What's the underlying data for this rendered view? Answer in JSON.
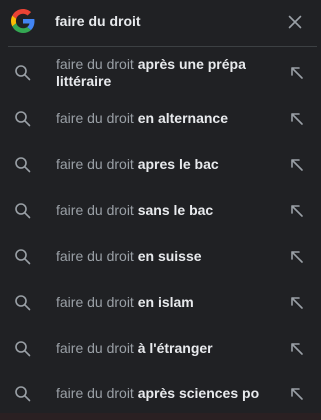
{
  "search": {
    "query": "faire du droit",
    "logo": "google-g-logo",
    "clear_icon": "close-icon"
  },
  "suggestions": [
    {
      "prefix": "faire du droit",
      "completion": "après une prépa",
      "completion2": "littéraire"
    },
    {
      "prefix": "faire du droit",
      "completion": "en alternance"
    },
    {
      "prefix": "faire du droit",
      "completion": "apres le bac"
    },
    {
      "prefix": "faire du droit",
      "completion": "sans le bac"
    },
    {
      "prefix": "faire du droit",
      "completion": "en suisse"
    },
    {
      "prefix": "faire du droit",
      "completion": "en islam"
    },
    {
      "prefix": "faire du droit",
      "completion": "à l'étranger"
    },
    {
      "prefix": "faire du droit",
      "completion": "après sciences po"
    }
  ],
  "icons": {
    "row_icon": "search-icon",
    "fill_icon": "arrow-up-left-icon"
  },
  "colors": {
    "background": "#202124",
    "text_primary": "#e8eaed",
    "text_secondary": "#9aa0a6"
  }
}
